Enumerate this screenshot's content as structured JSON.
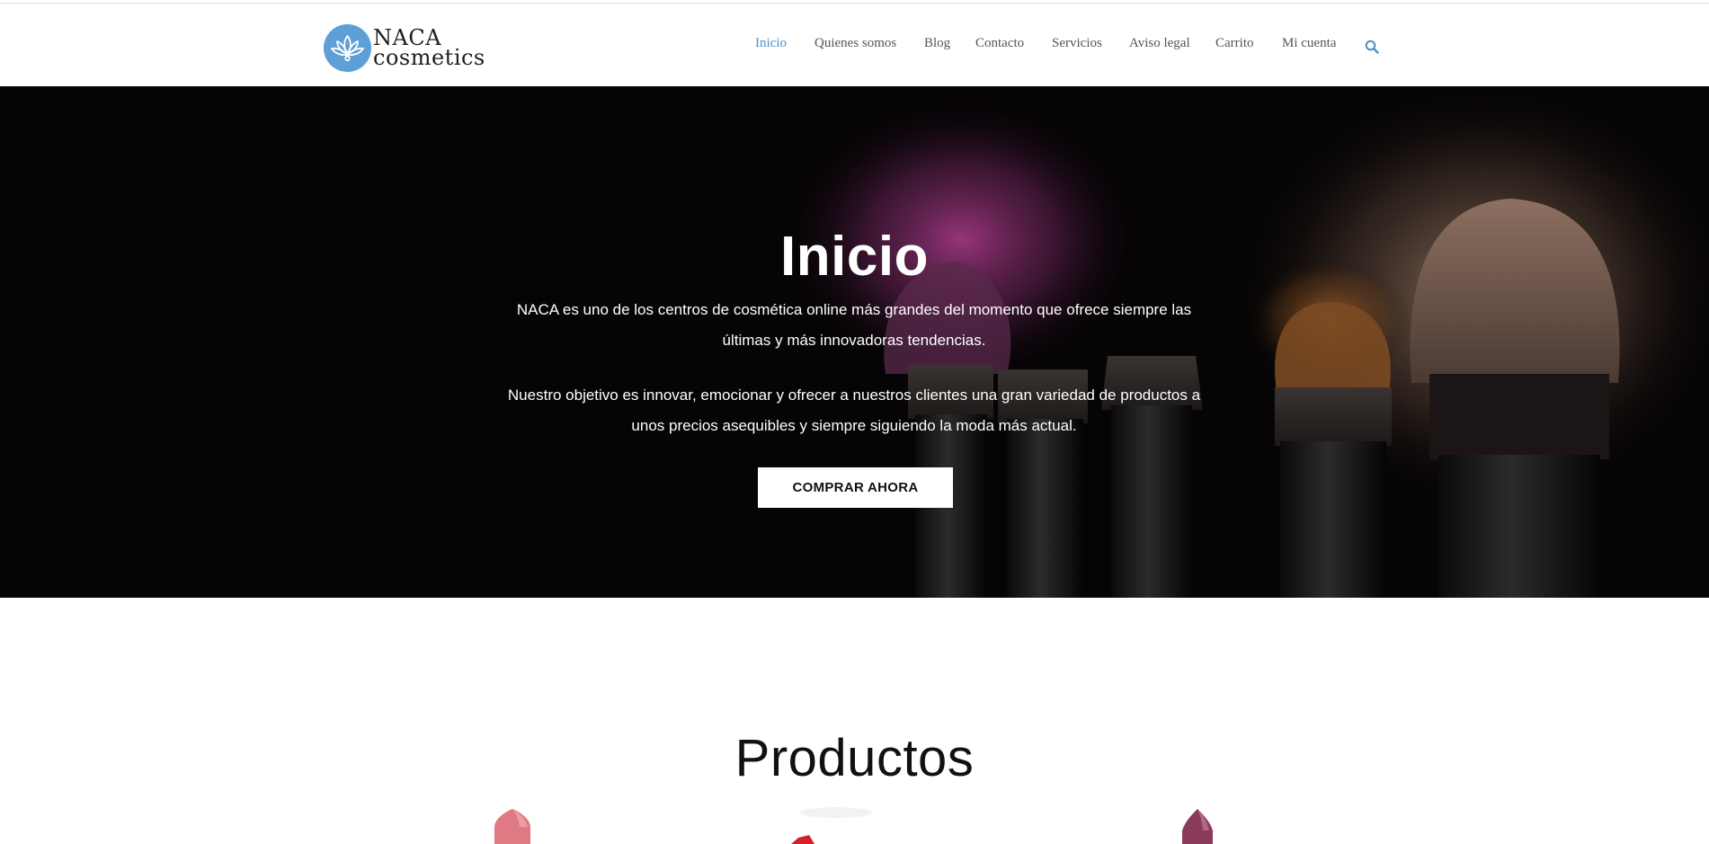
{
  "brand": {
    "name_line1": "NACA",
    "name_line2": "cosmetics",
    "logo_icon": "lotus-icon",
    "logo_color": "#5d9fd6"
  },
  "nav": {
    "items": [
      {
        "label": "Inicio",
        "active": true
      },
      {
        "label": "Quienes somos",
        "active": false
      },
      {
        "label": "Blog",
        "active": false
      },
      {
        "label": "Contacto",
        "active": false
      },
      {
        "label": "Servicios",
        "active": false
      },
      {
        "label": "Aviso legal",
        "active": false
      },
      {
        "label": "Carrito",
        "active": false
      },
      {
        "label": "Mi cuenta",
        "active": false
      }
    ],
    "search_icon": "search-icon",
    "active_color": "#4a90c8"
  },
  "hero": {
    "title": "Inicio",
    "paragraph1": "NACA es uno de los centros de cosmética online más grandes del momento que ofrece siempre las últimas y más innovadoras tendencias.",
    "paragraph2": "Nuestro objetivo es innovar, emocionar y ofrecer a nuestros clientes una gran variedad de productos a unos precios asequibles y siempre siguiendo la moda más actual.",
    "cta_label": "COMPRAR AHORA",
    "background_image": "makeup-brushes-with-powder"
  },
  "products": {
    "title": "Productos",
    "items": [
      {
        "image": "pink-lipstick"
      },
      {
        "image": "red-lipstick"
      },
      {
        "image": "plum-lipstick"
      }
    ]
  }
}
